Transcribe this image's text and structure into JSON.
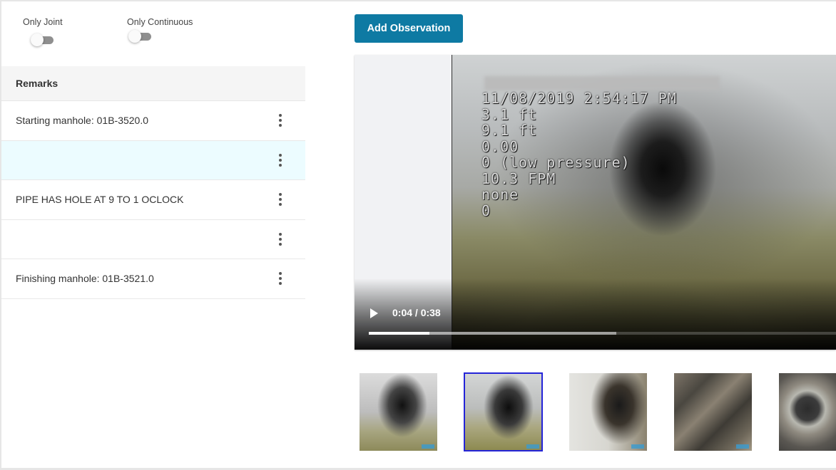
{
  "filters": {
    "only_joint": {
      "label": "Only Joint",
      "on": false
    },
    "only_continuous": {
      "label": "Only Continuous",
      "on": false
    }
  },
  "remarks": {
    "header": "Remarks",
    "rows": [
      {
        "text": "Starting manhole: 01B-3520.0",
        "selected": false
      },
      {
        "text": "",
        "selected": true
      },
      {
        "text": "PIPE HAS HOLE AT 9 TO 1 OCLOCK",
        "selected": false
      },
      {
        "text": "",
        "selected": false
      },
      {
        "text": "Finishing manhole: 01B-3521.0",
        "selected": false
      }
    ]
  },
  "toolbar": {
    "add_observation_label": "Add Observation"
  },
  "video": {
    "time_display": "0:04 / 0:38",
    "played_fraction": 0.13,
    "buffered_fraction": 0.53,
    "overlay_lines": [
      "11/08/2019 2:54:17 PM",
      "3.1 ft",
      "9.1 ft",
      "0.00",
      "0 (low pressure)",
      "10.3 FPM",
      "none",
      "0"
    ]
  },
  "thumbnails": {
    "count": 5,
    "selected_index": 1
  },
  "colors": {
    "accent": "#0e7aa3",
    "selected_row": "#ecfcff",
    "selected_thumb_border": "#2424d8"
  }
}
